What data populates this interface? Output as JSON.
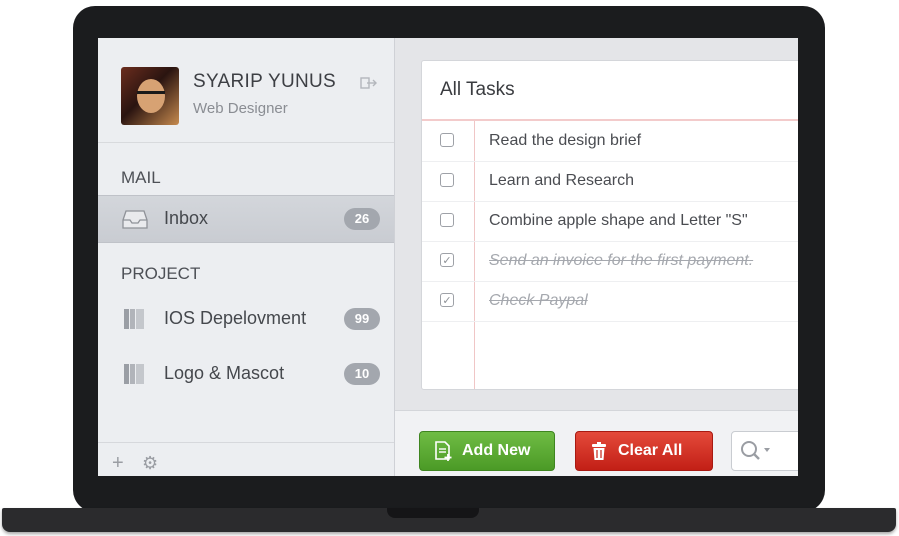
{
  "user": {
    "name": "SYARIP YUNUS",
    "role": "Web Designer"
  },
  "sidebar": {
    "mail_label": "MAIL",
    "project_label": "PROJECT",
    "items": [
      {
        "label": "Inbox",
        "badge": "26",
        "icon": "inbox-tray-icon",
        "active": true
      },
      {
        "label": "IOS Depelovment",
        "badge": "99",
        "icon": "book-icon"
      },
      {
        "label": "Logo & Mascot",
        "badge": "10",
        "icon": "book-icon"
      }
    ],
    "footer": {
      "add_glyph": "+",
      "settings_glyph": "⚙"
    }
  },
  "tasks": {
    "title": "All Tasks",
    "items": [
      {
        "text": "Read the design brief",
        "done": false
      },
      {
        "text": "Learn and Research",
        "done": false
      },
      {
        "text": "Combine apple shape and Letter \"S\"",
        "done": false
      },
      {
        "text": "Send an invoice for the first payment.",
        "done": true
      },
      {
        "text": "Check Paypal",
        "done": true
      }
    ],
    "check_mark": "✓"
  },
  "toolbar": {
    "add_label": "Add New",
    "clear_label": "Clear All"
  },
  "colors": {
    "add_green": "#5aab33",
    "clear_red": "#d3342a",
    "badge_gray": "#a3a7ae"
  }
}
